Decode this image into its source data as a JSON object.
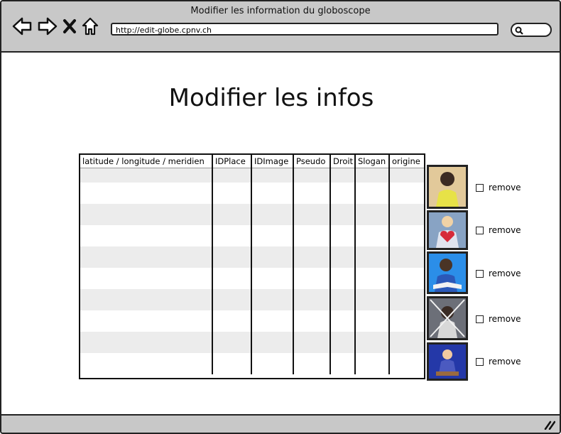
{
  "window": {
    "title": "Modifier les information du globoscope"
  },
  "browser": {
    "url": "http://edit-globe.cpnv.ch"
  },
  "page": {
    "title": "Modifier les infos"
  },
  "table": {
    "headers": [
      "latitude / longitude / meridien",
      "IDPlace",
      "IDImage",
      "Pseudo",
      "Droit",
      "Slogan",
      "origine"
    ]
  },
  "photos": [
    {
      "label": "remove",
      "background": "#e2c99a"
    },
    {
      "label": "remove",
      "background": "#88a3c4"
    },
    {
      "label": "remove",
      "background": "#2b8ee8"
    },
    {
      "label": "remove",
      "background": "#6c6f78"
    },
    {
      "label": "remove",
      "background": "#2438a8"
    }
  ],
  "colors": {
    "chrome": "#c8c8c8",
    "stripe": "#ececec"
  }
}
